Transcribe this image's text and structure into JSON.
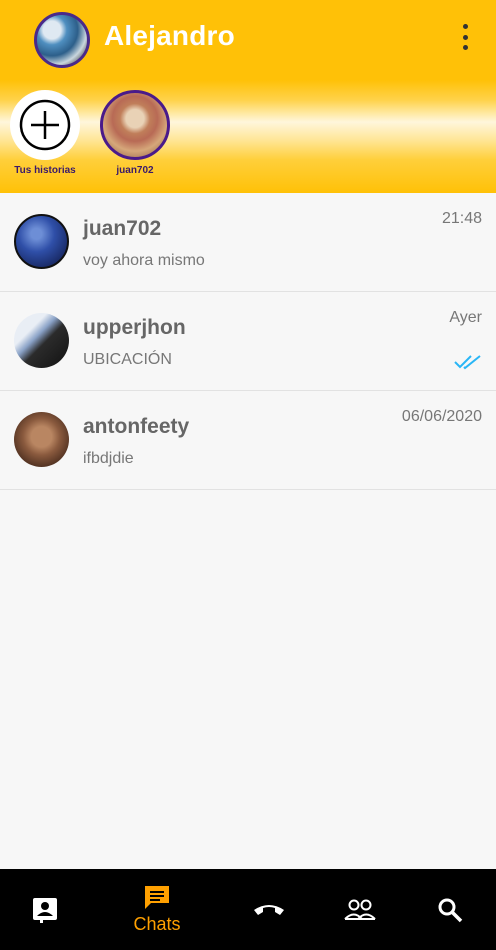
{
  "header": {
    "user_name": "Alejandro",
    "menu_icon": "more-vert-icon"
  },
  "stories": [
    {
      "label": "Tus historias",
      "icon": "add-circle-icon"
    },
    {
      "label": "juan702"
    }
  ],
  "chats": [
    {
      "name": "juan702",
      "message": "voy ahora mismo",
      "time": "21:48",
      "read": false
    },
    {
      "name": "upperjhon",
      "message": "UBICACIÓN",
      "time": "Ayer",
      "read": true
    },
    {
      "name": "antonfeety",
      "message": "ifbdjdie",
      "time": "06/06/2020",
      "read": false
    }
  ],
  "nav": {
    "contacts_icon": "contacts-icon",
    "chats_label": "Chats",
    "calls_icon": "phone-icon",
    "groups_icon": "groups-icon",
    "search_icon": "search-icon"
  },
  "colors": {
    "header": "#ffc107",
    "accent": "#ffa000",
    "read_check": "#29b6f6",
    "nav_background": "#000000"
  }
}
